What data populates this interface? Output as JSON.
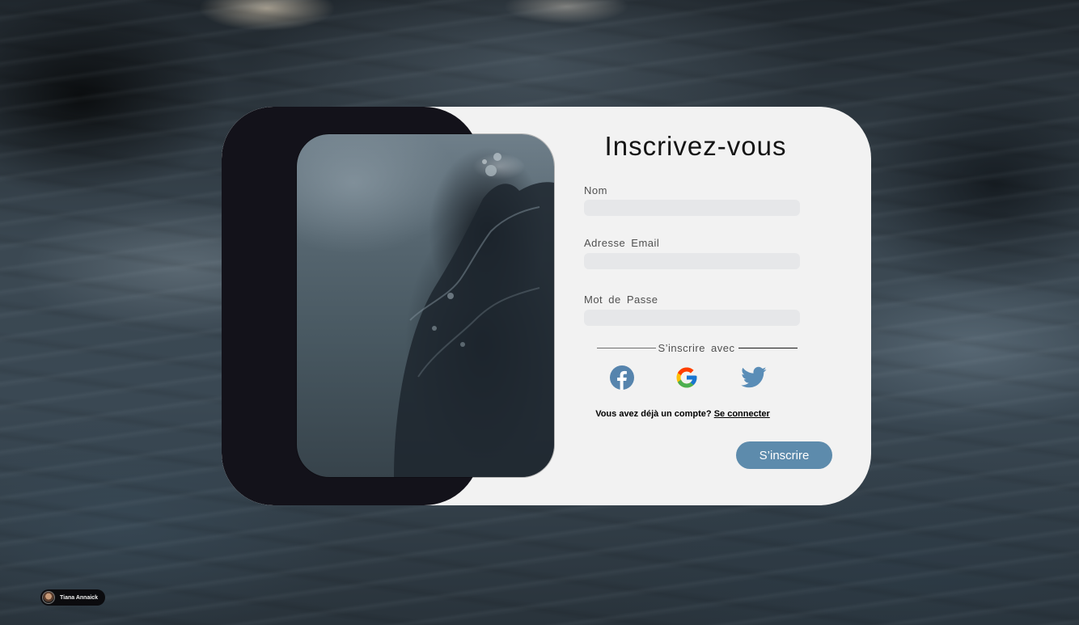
{
  "form": {
    "title": "Inscrivez-vous",
    "fields": [
      {
        "label": "Nom",
        "value": "",
        "placeholder": ""
      },
      {
        "label": "Adresse  Email",
        "value": "",
        "placeholder": ""
      },
      {
        "label": "Mot  de  Passe",
        "value": "",
        "placeholder": ""
      }
    ],
    "social_divider": "S’inscrire  avec",
    "social_icons": [
      "facebook-icon",
      "google-icon",
      "twitter-icon"
    ],
    "account_question": "Vous avez déjà un compte?",
    "login_link": "Se connecter",
    "submit_label": "S’inscrire"
  },
  "credit": {
    "name": "Tiana Annaick"
  },
  "colors": {
    "accent": "#5d8bac",
    "card": "#f2f2f2",
    "dark_panel": "#13121a",
    "input": "#e6e7e9",
    "facebook": "#5684ad",
    "twitter": "#5a8db7"
  }
}
